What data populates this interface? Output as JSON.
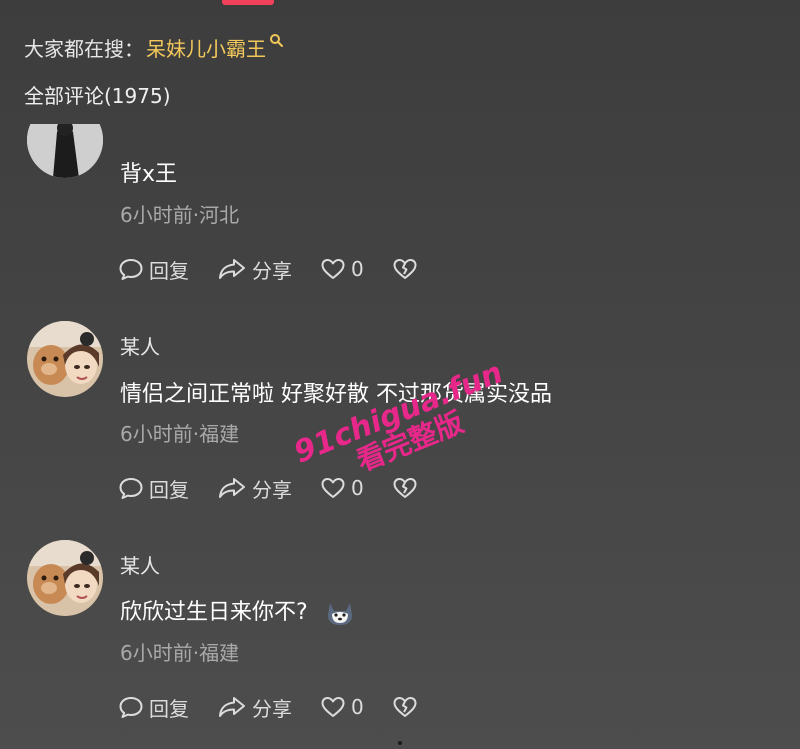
{
  "search": {
    "prefix": "大家都在搜：",
    "keyword": "呆妹儿小霸王"
  },
  "comments_header": "全部评论(1975)",
  "comments": [
    {
      "username": "",
      "text": "背x王",
      "time": "6小时前",
      "location": "河北",
      "meta": "6小时前·河北",
      "reply_label": "回复",
      "share_label": "分享",
      "like_count": "0"
    },
    {
      "username": "某人",
      "text": "情侣之间正常啦 好聚好散 不过那货属实没品",
      "time": "6小时前",
      "location": "福建",
      "meta": "6小时前·福建",
      "reply_label": "回复",
      "share_label": "分享",
      "like_count": "0"
    },
    {
      "username": "某人",
      "text": "欣欣过生日来你不?",
      "time": "6小时前",
      "location": "福建",
      "meta": "6小时前·福建",
      "reply_label": "回复",
      "share_label": "分享",
      "like_count": "0"
    }
  ],
  "watermark": {
    "line1": "91chigua.fun",
    "line2": "看完整版"
  },
  "colors": {
    "accent": "#f0405a",
    "keyword": "#f2c85a",
    "watermark": "#e8278a"
  },
  "icons": {
    "search": "search-icon",
    "reply": "comment-bubble-icon",
    "share": "share-arrow-icon",
    "like": "heart-icon",
    "dislike": "broken-heart-icon"
  }
}
